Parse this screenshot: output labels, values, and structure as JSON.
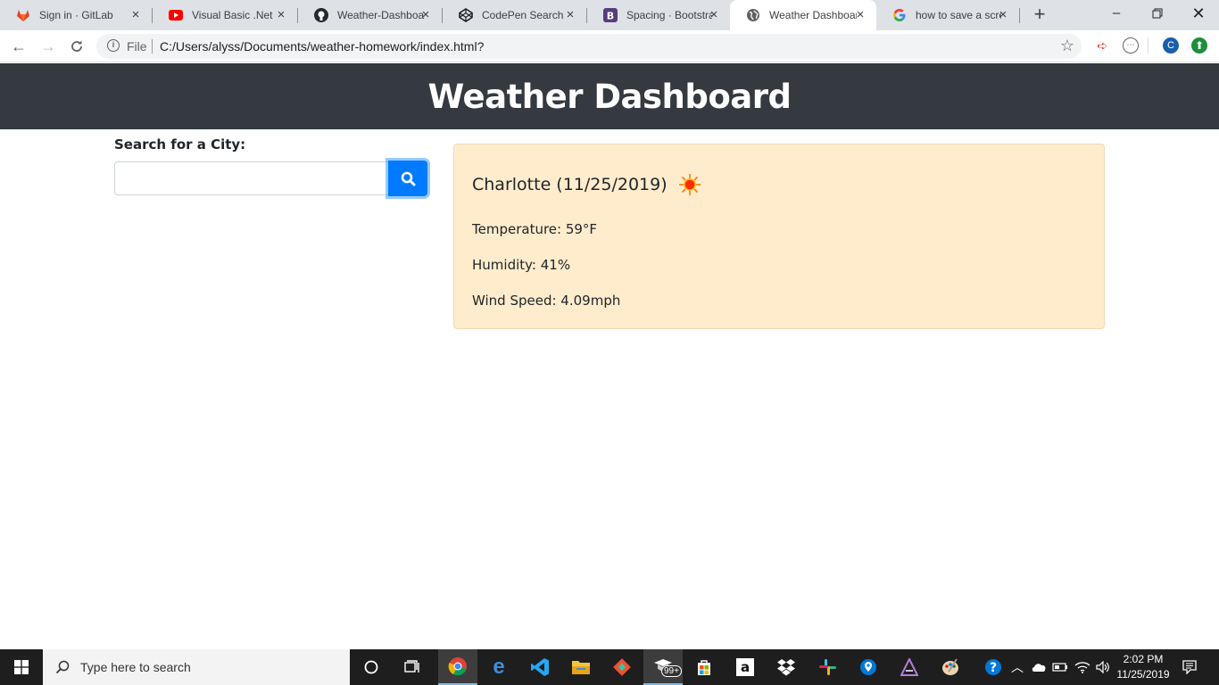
{
  "browser": {
    "tabs": [
      {
        "title": "Sign in · GitLab",
        "icon": "gitlab-icon",
        "active": false
      },
      {
        "title": "Visual Basic .Net : S",
        "icon": "youtube-icon",
        "active": false
      },
      {
        "title": "Weather-Dashboard",
        "icon": "github-icon",
        "active": false
      },
      {
        "title": "CodePen Search",
        "icon": "codepen-icon",
        "active": false
      },
      {
        "title": "Spacing · Bootstrap",
        "icon": "bootstrap-icon",
        "active": false
      },
      {
        "title": "Weather Dashboard",
        "icon": "globe-icon",
        "active": true
      },
      {
        "title": "how to save a scree",
        "icon": "google-icon",
        "active": false
      }
    ],
    "address": {
      "scheme_label": "File",
      "url": "C:/Users/alyss/Documents/weather-homework/index.html?"
    },
    "profile_initial": "C"
  },
  "page": {
    "header_title": "Weather Dashboard",
    "search": {
      "label": "Search for a City:",
      "value": "",
      "placeholder": ""
    },
    "current": {
      "title": "Charlotte (11/25/2019)",
      "icon": "sun-icon",
      "temperature": "Temperature: 59°F",
      "humidity": "Humidity: 41%",
      "wind": "Wind Speed: 4.09mph"
    }
  },
  "taskbar": {
    "search_placeholder": "Type here to search",
    "mail_badge": "99+",
    "time": "2:02 PM",
    "date": "11/25/2019"
  },
  "colors": {
    "header_bg": "#343a40",
    "card_bg": "#ffeccc",
    "button_bg": "#007bff"
  }
}
